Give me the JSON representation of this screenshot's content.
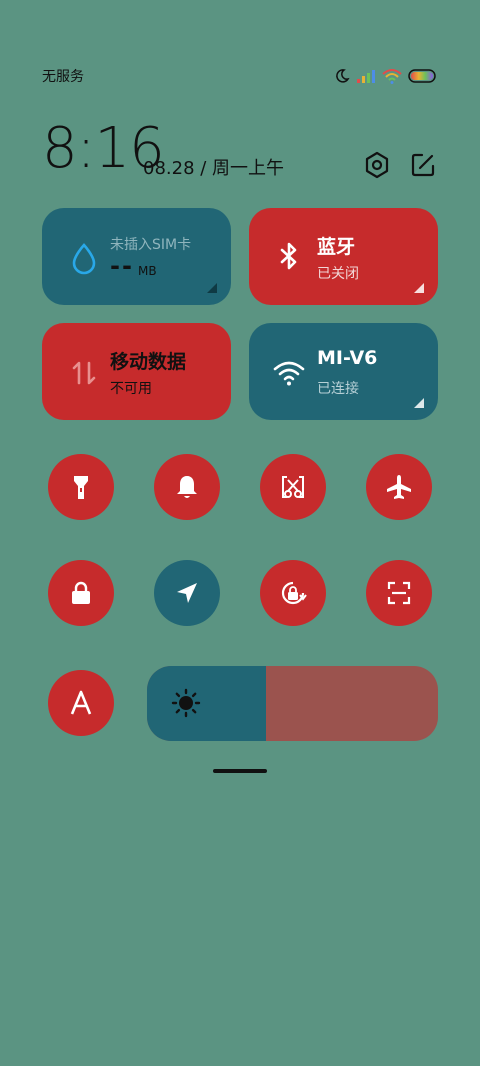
{
  "status": {
    "carrier": "无服务"
  },
  "clock": {
    "time": "8:16",
    "date": "08.28 / 周一上午"
  },
  "tiles": {
    "data_usage": {
      "title": "未插入SIM卡",
      "value": "--",
      "unit": "MB"
    },
    "bluetooth": {
      "title": "蓝牙",
      "sub": "已关闭"
    },
    "mobile_data": {
      "title": "移动数据",
      "sub": "不可用"
    },
    "wifi": {
      "title": "MI-V6",
      "sub": "已连接"
    }
  },
  "toggles_row1": [
    "flashlight-icon",
    "bell-icon",
    "screenshot-cut-icon",
    "airplane-icon"
  ],
  "toggles_row2": [
    "lock-icon",
    "location-icon",
    "rotation-lock-icon",
    "scan-icon"
  ],
  "toggles_row3": [
    "auto-brightness-icon"
  ],
  "brightness": {
    "level": 0.41
  },
  "colors": {
    "active_blue": "#216675",
    "inactive_red": "#c62b2c",
    "background": "#5b9482",
    "slider_track": "#9b534e"
  }
}
